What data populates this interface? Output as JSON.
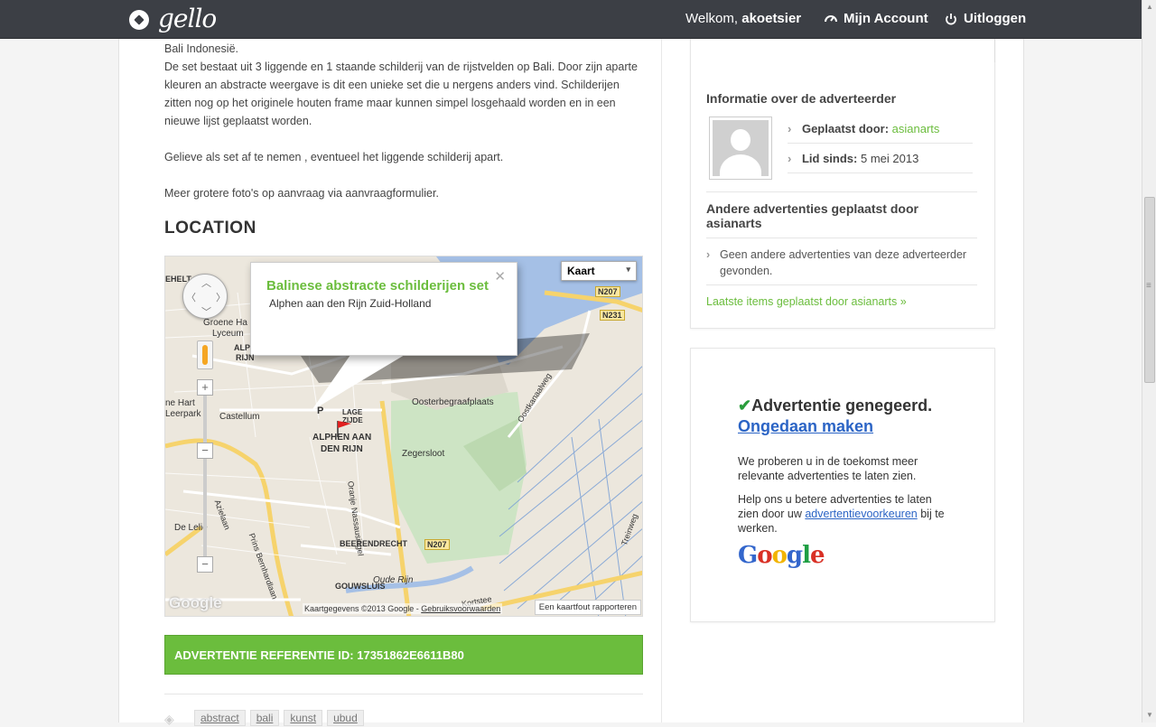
{
  "header": {
    "logo_text": "gello",
    "welcome_prefix": "Welkom,",
    "username": "akoetsier",
    "account_label": "Mijn Account",
    "logout_label": "Uitloggen"
  },
  "description": {
    "line1": "Bali Indonesië.",
    "line2": "De set bestaat uit 3 liggende en 1 staande schilderij van de rijstvelden op Bali. Door zijn aparte kleuren an abstracte weergave is dit een unieke set die u nergens anders vind. Schilderijen zitten nog op het originele houten frame maar kunnen simpel losgehaald worden en in een nieuwe lijst geplaatst worden.",
    "para2": "Gelieve als set af te nemen , eventueel het liggende schilderij apart.",
    "para3": "Meer grotere foto's op aanvraag via aanvraagformulier."
  },
  "location": {
    "title": "LOCATION",
    "map_type": "Kaart",
    "info_title": "Balinese abstracte schilderijen set",
    "info_subtitle": "Alphen aan den Rijn Zuid-Holland",
    "attribution": "Kaartgegevens ©2013 Google -",
    "terms": "Gebruiksvoorwaarden",
    "report": "Een kaartfout rapporteren",
    "watermark": "Google",
    "labels": {
      "alphen": "ALPHEN AAN",
      "den_rijn": "DEN RIJN",
      "lage": "LAGE",
      "zijde": "ZIJDE",
      "oosterbegraafplaats": "Oosterbegraafplaats",
      "zegersloot": "Zegersloot",
      "beerendrecht": "BEERENDRECHT",
      "gouwsluis": "GOUWSLUIS",
      "oude_rijn": "Oude Rijn",
      "castellum": "Castellum",
      "de_lelie": "De Lelie",
      "groene_hart_lyceum": "Groene Ha",
      "lyceum": "Lyceum",
      "ehelt": "EHELT",
      "alp": "ALP",
      "rijn_left": "RIJN",
      "ne_hart": "ne Hart",
      "leerpark": "Leerpark",
      "oranje": "Oranje Nassausingel",
      "oostkanaalweg": "Oostkanaalweg",
      "treinweg": "Treinweg",
      "prins": "Prins Bernhardlaan",
      "azielaan": "Azielaan",
      "kortsteelaan": "Kortstee",
      "p_marker": "P"
    },
    "roads": [
      "N207",
      "N231",
      "N207"
    ]
  },
  "reference": {
    "label": "ADVERTENTIE REFERENTIE ID: 17351862E6611B80"
  },
  "tags": [
    "abstract",
    "bali",
    "kunst",
    "ubud"
  ],
  "advertiser": {
    "title": "Informatie over de adverteerder",
    "posted_by_label": "Geplaatst door:",
    "posted_by_value": "asianarts",
    "member_since_label": "Lid sinds:",
    "member_since_value": "5 mei 2013",
    "other_title": "Andere advertenties geplaatst door asianarts",
    "other_text": "Geen andere advertenties van deze adverteerder gevonden.",
    "latest_link": "Laatste items geplaatst door asianarts »"
  },
  "ad_notice": {
    "title": "Advertentie genegeerd.",
    "undo": "Ongedaan maken",
    "para1": "We proberen u in de toekomst meer relevante advertenties te laten zien.",
    "para2_prefix": "Help ons u betere advertenties te laten zien door uw",
    "para2_link": "advertentievoorkeuren",
    "para2_suffix": "bij te werken.",
    "google_logo": "Google"
  },
  "colors": {
    "brand_green": "#6bbd3d",
    "header_bg": "#3c3f45",
    "link_blue": "#2b64c5"
  }
}
